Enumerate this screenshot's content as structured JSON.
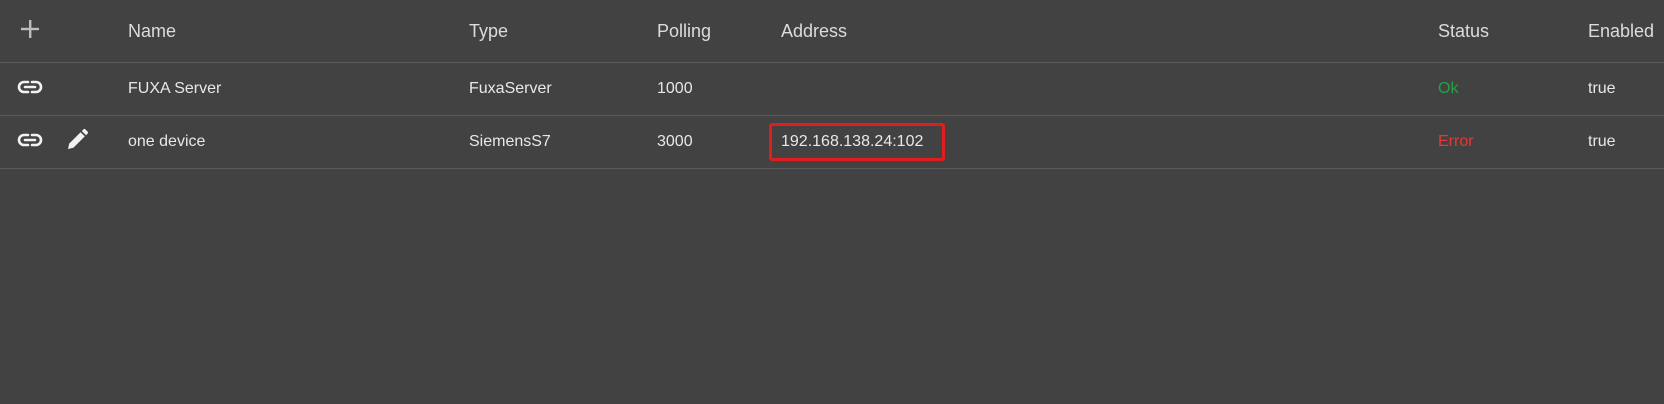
{
  "header": {
    "add_icon": "plus-icon",
    "columns": {
      "name": "Name",
      "type": "Type",
      "polling": "Polling",
      "address": "Address",
      "status": "Status",
      "enabled": "Enabled"
    }
  },
  "rows": [
    {
      "icons": [
        "link-icon"
      ],
      "name": "FUXA Server",
      "type": "FuxaServer",
      "polling": "1000",
      "address": "",
      "status": "Ok",
      "status_color": "#22a245",
      "enabled": "true"
    },
    {
      "icons": [
        "link-icon",
        "pencil-icon"
      ],
      "name": "one device",
      "type": "SiemensS7",
      "polling": "3000",
      "address": "192.168.138.24:102",
      "address_highlight_color": "#e11d1d",
      "status": "Error",
      "status_color": "#e53935",
      "enabled": "true"
    }
  ],
  "colors": {
    "background": "#424242",
    "divider": "#5a5a5a",
    "text": "#e8e8e8"
  }
}
